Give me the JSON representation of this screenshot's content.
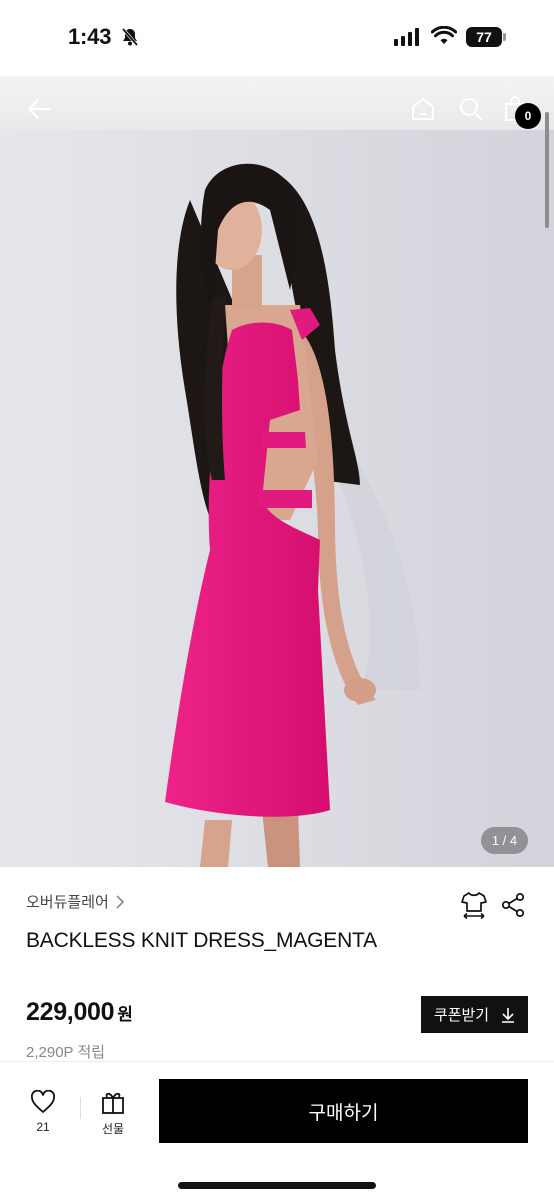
{
  "status_bar": {
    "time": "1:43",
    "battery": "77",
    "icons": [
      "bell-off-icon",
      "signal-icon",
      "wifi-icon",
      "battery-icon"
    ]
  },
  "nav": {
    "icons": [
      "back-arrow-icon",
      "home-icon",
      "search-icon",
      "shopping-bag-icon"
    ],
    "cart_count": "0"
  },
  "hero": {
    "image_alt": "model wearing magenta backless knit dress",
    "counter": "1 / 4"
  },
  "product": {
    "brand": "오버듀플레어",
    "title": "BACKLESS KNIT DRESS_MAGENTA",
    "price": "229,000",
    "currency": "원",
    "points": "2,290P 적립",
    "coupon_label": "쿠폰받기"
  },
  "bottom_bar": {
    "like_count": "21",
    "gift_label": "선물",
    "buy_label": "구매하기"
  },
  "colors": {
    "accent": "#000000",
    "dress": "#e5157a",
    "background": "#e2e3e8"
  }
}
